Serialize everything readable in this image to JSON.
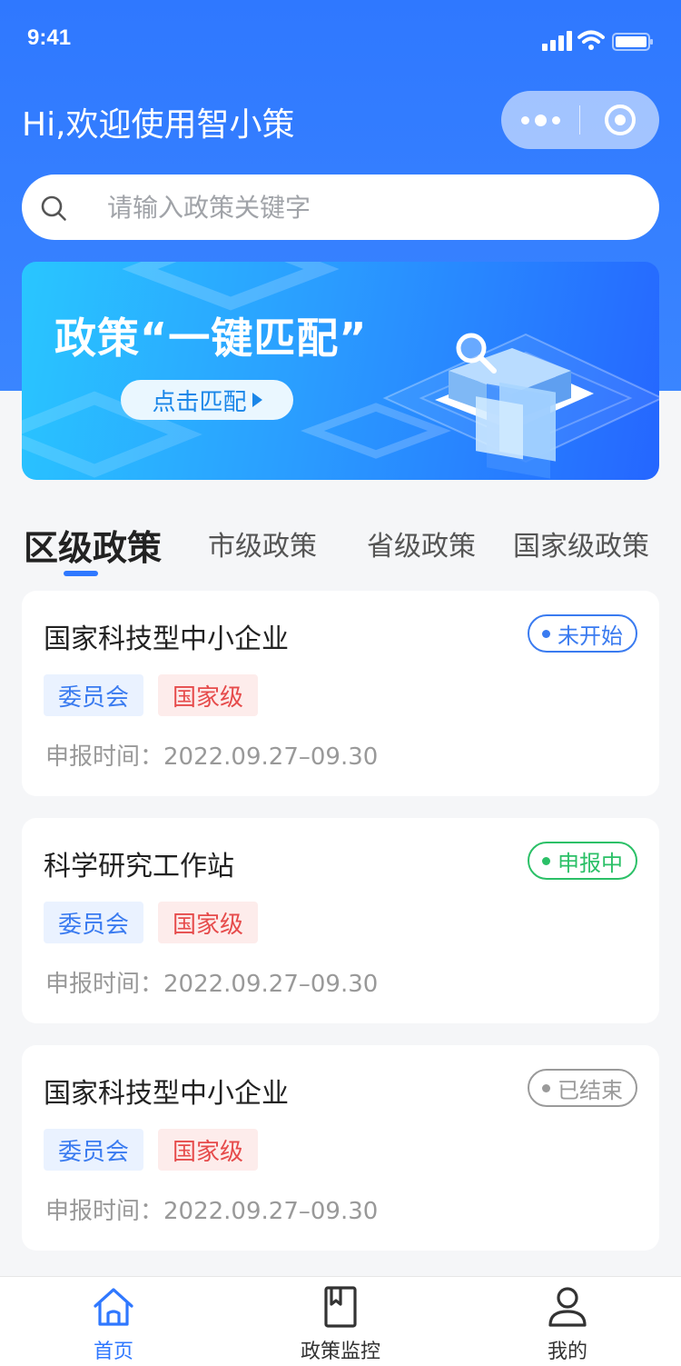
{
  "status_bar": {
    "time": "9:41"
  },
  "header": {
    "greeting": "Hi,欢迎使用智小策"
  },
  "search": {
    "placeholder": "请输入政策关键字"
  },
  "banner": {
    "title": "政策“一键匹配”",
    "button_label": "点击匹配"
  },
  "tabs": [
    {
      "label": "区级政策",
      "active": true
    },
    {
      "label": "市级政策",
      "active": false
    },
    {
      "label": "省级政策",
      "active": false
    },
    {
      "label": "国家级政策",
      "active": false
    }
  ],
  "policies": [
    {
      "title": "国家科技型中小企业",
      "status": "未开始",
      "status_color": "#3a7bf0",
      "org_tag": "委员会",
      "level_tag": "国家级",
      "date": "申报时间：2022.09.27–09.30"
    },
    {
      "title": "科学研究工作站",
      "status": "申报中",
      "status_color": "#2bc067",
      "org_tag": "委员会",
      "level_tag": "国家级",
      "date": "申报时间：2022.09.27–09.30"
    },
    {
      "title": "国家科技型中小企业",
      "status": "已结束",
      "status_color": "#9a9a9a",
      "org_tag": "委员会",
      "level_tag": "国家级",
      "date": "申报时间：2022.09.27–09.30"
    }
  ],
  "tabbar": [
    {
      "label": "首页",
      "icon": "home-icon",
      "active": true
    },
    {
      "label": "政策监控",
      "icon": "book-icon",
      "active": false
    },
    {
      "label": "我的",
      "icon": "user-icon",
      "active": false
    }
  ],
  "colors": {
    "primary": "#2f78ff",
    "status_not_started": "#3a7bf0",
    "status_in_progress": "#2bc067",
    "status_ended": "#9a9a9a"
  }
}
